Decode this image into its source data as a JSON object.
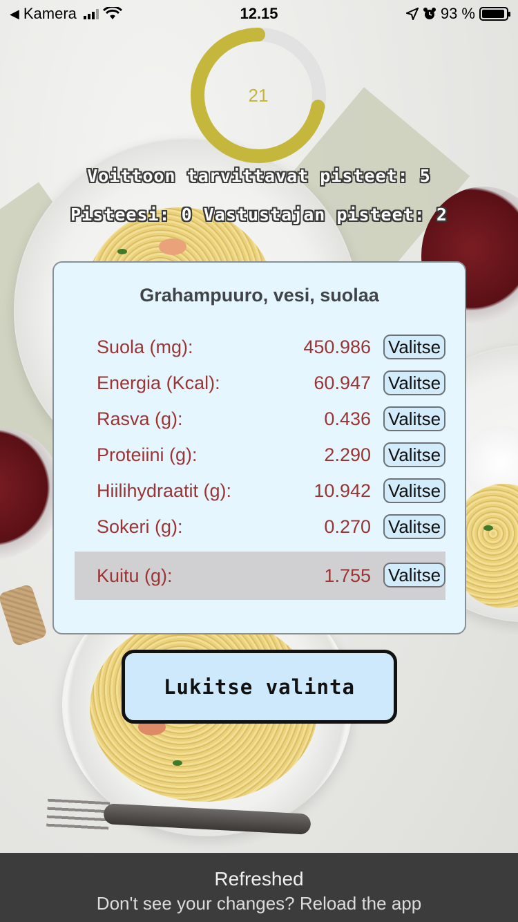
{
  "status_bar": {
    "back_label": "Kamera",
    "time": "12.15",
    "battery_text": "93 %",
    "battery_level": 0.93
  },
  "timer": {
    "seconds_left": "21",
    "progress_fraction": 0.72,
    "ring_color": "#c5b73b",
    "track_color": "#e2e2e2"
  },
  "game": {
    "goal_line": "Voittoon tarvittavat pisteet: 5",
    "score_line": "Pisteesi: 0 Vastustajan pisteet: 2"
  },
  "card": {
    "title": "Grahampuuro, vesi, suolaa",
    "rows": [
      {
        "label": "Suola (mg):",
        "value": "450.986",
        "button": "Valitse"
      },
      {
        "label": "Energia (Kcal):",
        "value": "60.947",
        "button": "Valitse"
      },
      {
        "label": "Rasva (g):",
        "value": "0.436",
        "button": "Valitse"
      },
      {
        "label": "Proteiini (g):",
        "value": "2.290",
        "button": "Valitse"
      },
      {
        "label": "Hiilihydraatit (g):",
        "value": "10.942",
        "button": "Valitse"
      },
      {
        "label": "Sokeri (g):",
        "value": "0.270",
        "button": "Valitse"
      },
      {
        "label": "Kuitu (g):",
        "value": "1.755",
        "button": "Valitse",
        "selected": true
      }
    ]
  },
  "lock_button": {
    "label": "Lukitse valinta"
  },
  "toast": {
    "title": "Refreshed",
    "message": "Don't see your changes? Reload the app"
  },
  "colors": {
    "card_bg": "#e5f6fe",
    "value_text": "#9b3433",
    "button_bg": "#d2ecfb",
    "selected_row": "#d0d0d2"
  }
}
